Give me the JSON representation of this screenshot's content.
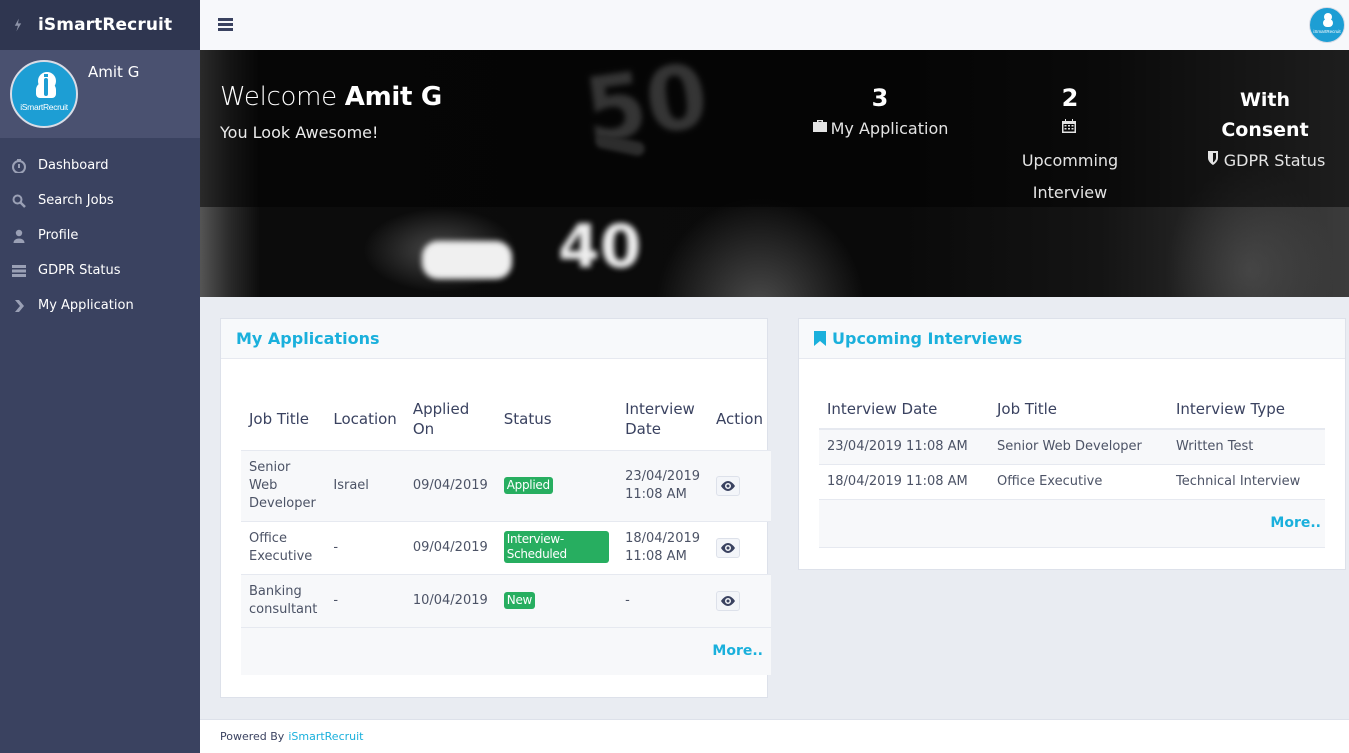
{
  "app": {
    "name": "iSmartRecruit",
    "logo_text": "iSmartRecruit"
  },
  "user": {
    "name": "Amit G"
  },
  "sidebar": {
    "items": [
      {
        "label": "Dashboard",
        "icon": "stopwatch-icon"
      },
      {
        "label": "Search Jobs",
        "icon": "search-icon"
      },
      {
        "label": "Profile",
        "icon": "user-icon"
      },
      {
        "label": "GDPR Status",
        "icon": "server-icon"
      },
      {
        "label": "My Application",
        "icon": "chevron-right-icon"
      }
    ]
  },
  "hero": {
    "welcome_prefix": "Welcome ",
    "welcome_name": "Amit G",
    "tagline": "You Look Awesome!",
    "stats": {
      "applications": {
        "value": "3",
        "label": "My Application"
      },
      "interviews": {
        "value": "2",
        "label": "Upcomming Interview"
      },
      "gdpr": {
        "value": "With Consent",
        "label": "GDPR Status"
      }
    }
  },
  "applications": {
    "title": "My Applications",
    "columns": [
      "Job Title",
      "Location",
      "Applied On",
      "Status",
      "Interview Date",
      "Action"
    ],
    "rows": [
      {
        "job_title": "Senior Web Developer",
        "location": "Israel",
        "applied_on": "09/04/2019",
        "status": "Applied",
        "interview_date": "23/04/2019 11:08 AM"
      },
      {
        "job_title": "Office Executive",
        "location": "-",
        "applied_on": "09/04/2019",
        "status": "Interview-Scheduled",
        "interview_date": "18/04/2019 11:08 AM"
      },
      {
        "job_title": "Banking consultant",
        "location": "-",
        "applied_on": "10/04/2019",
        "status": "New",
        "interview_date": "-"
      }
    ],
    "more_label": "More.."
  },
  "interviews": {
    "title": "Upcoming Interviews",
    "columns": [
      "Interview Date",
      "Job Title",
      "Interview Type"
    ],
    "rows": [
      {
        "date": "23/04/2019 11:08 AM",
        "job_title": "Senior Web Developer",
        "type": "Written Test"
      },
      {
        "date": "18/04/2019 11:08 AM",
        "job_title": "Office Executive",
        "type": "Technical Interview"
      }
    ],
    "more_label": "More.."
  },
  "footer": {
    "prefix": "Powered By",
    "link": "iSmartRecruit"
  },
  "colors": {
    "sidebar": "#3a4260",
    "accent": "#1ab0dc",
    "status_green": "#27ae60"
  }
}
